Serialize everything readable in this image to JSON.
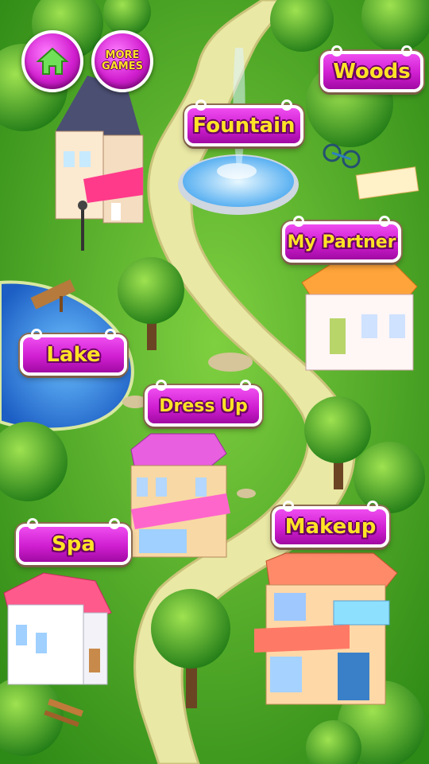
{
  "top_buttons": {
    "home_icon": "home-icon",
    "more_games_label": "MORE\nGAMES"
  },
  "locations": {
    "woods": "Woods",
    "fountain": "Fountain",
    "my_partner": "My Partner",
    "lake": "Lake",
    "dress_up": "Dress Up",
    "spa": "Spa",
    "makeup": "Makeup"
  },
  "colors": {
    "grass": "#3fa520",
    "path": "#e9e8a4",
    "water": "#2f7fd6",
    "sign_fill": "#d21fd0",
    "sign_text": "#ffe326"
  }
}
